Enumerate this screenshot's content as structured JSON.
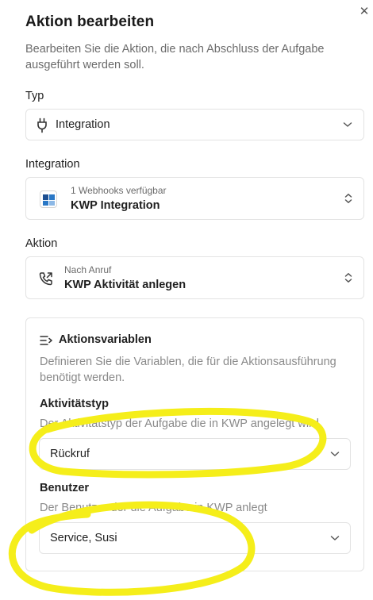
{
  "dialog": {
    "close_glyph": "✕",
    "title": "Aktion bearbeiten",
    "subtitle": "Bearbeiten Sie die Aktion, die nach Abschluss der Aufgabe ausgeführt werden soll."
  },
  "type_field": {
    "label": "Typ",
    "value": "Integration",
    "icon": "plug-icon"
  },
  "integration_field": {
    "label": "Integration",
    "caption": "1 Webhooks verfügbar",
    "value": "KWP Integration",
    "icon": "kwp-logo"
  },
  "action_field": {
    "label": "Aktion",
    "caption": "Nach Anruf",
    "value": "KWP Aktivität anlegen",
    "icon": "phone-outgoing-icon"
  },
  "action_variables": {
    "heading": "Aktionsvariablen",
    "icon": "list-arrow-icon",
    "description": "Definieren Sie die Variablen, die für die Aktionsausführung benötigt werden.",
    "fields": [
      {
        "label": "Aktivitätstyp",
        "description": "Der Aktivitätstyp der Aufgabe die in KWP angelegt wird",
        "value": "Rückruf"
      },
      {
        "label": "Benutzer",
        "description": "Der Benutzer der die Aufgabe in KWP anlegt",
        "value": "Service, Susi"
      }
    ]
  },
  "annotations": {
    "highlight_color": "#f5ee1a"
  }
}
